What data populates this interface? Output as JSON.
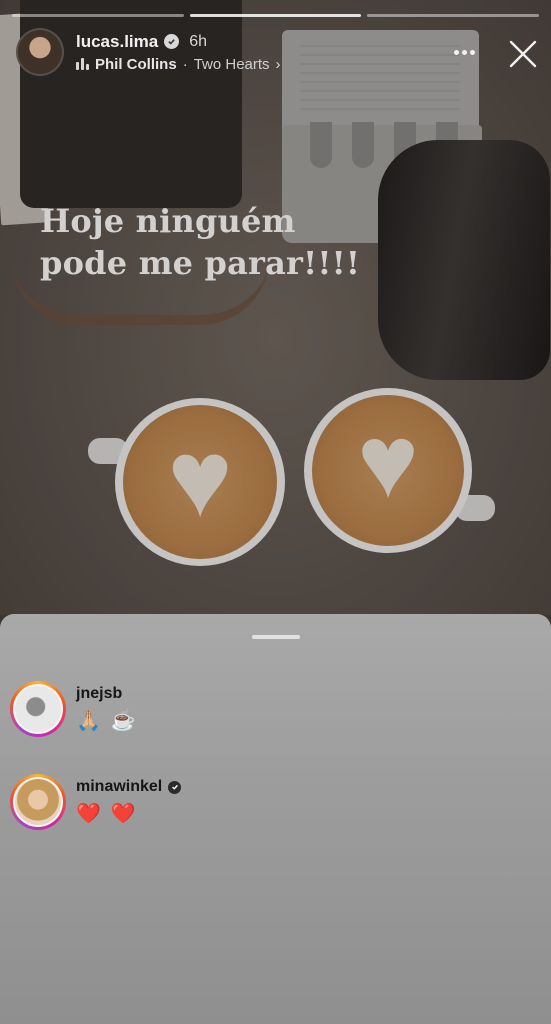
{
  "story": {
    "username": "lucas.lima",
    "verified": true,
    "time_ago": "6h",
    "music": {
      "artist": "Phil Collins",
      "separator": "·",
      "song": "Two Hearts",
      "chevron": "›"
    },
    "caption_line1": "Hoje ninguém",
    "caption_line2": "pode me parar!!!!",
    "progress_segments": 3,
    "active_segment": 2,
    "icons": {
      "more": "more-dots-icon",
      "close": "close-icon",
      "music": "music-bars-icon"
    }
  },
  "sheet": {
    "comments": [
      {
        "username": "jnejsb",
        "verified": false,
        "message": "🙏🏼 ☕️"
      },
      {
        "username": "minawinkel",
        "verified": true,
        "message": "❤️ ❤️"
      }
    ]
  }
}
